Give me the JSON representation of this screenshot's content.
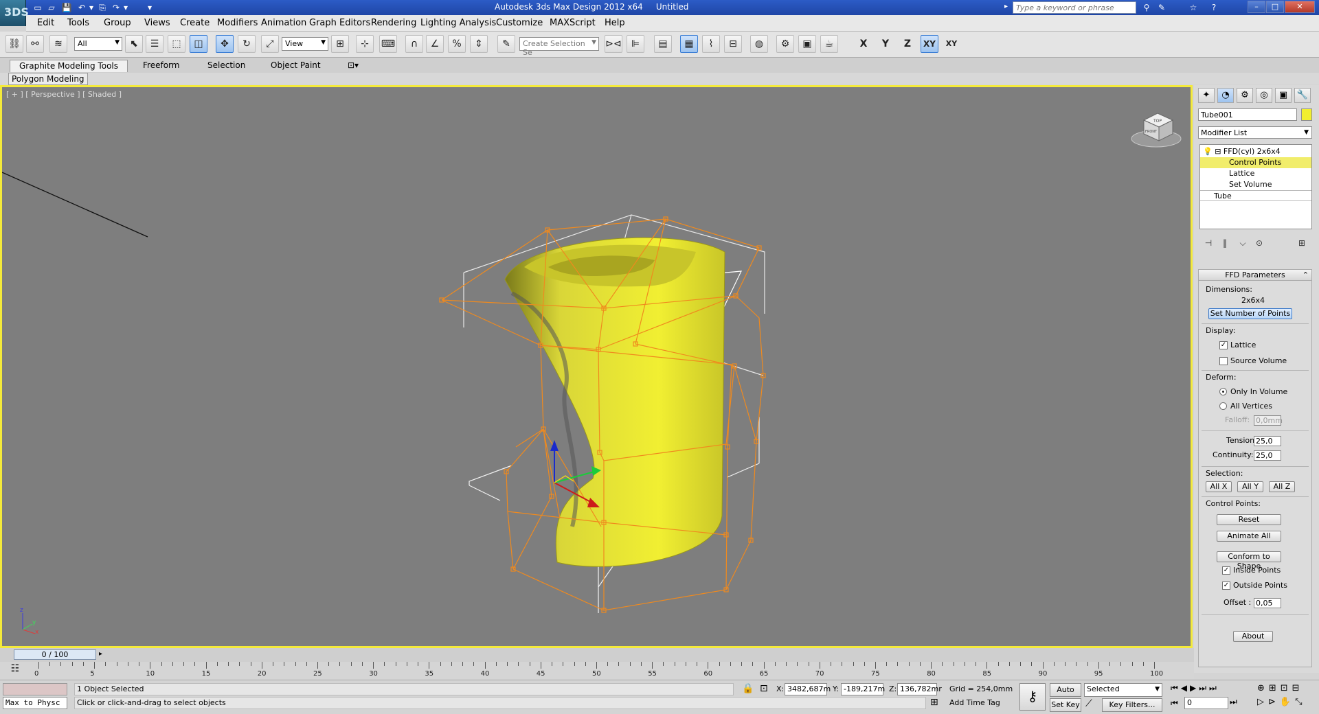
{
  "window": {
    "app_logo": "3DS",
    "title": "Autodesk 3ds Max Design 2012 x64     Untitled",
    "search_placeholder": "Type a keyword or phrase",
    "min": "–",
    "max": "□",
    "close": "✕"
  },
  "quick_access": [
    "▭",
    "▱",
    "💾",
    "↶",
    "▾",
    "⎘",
    "↷",
    "▾",
    "▾"
  ],
  "menu": [
    "Edit",
    "Tools",
    "Group",
    "Views",
    "Create",
    "Modifiers",
    "Animation",
    "Graph Editors",
    "Rendering",
    "Lighting Analysis",
    "Customize",
    "MAXScript",
    "Help"
  ],
  "toolbar": {
    "filter_value": "All",
    "refcoord_value": "View",
    "selection_set_placeholder": "Create Selection Se",
    "axis": {
      "x": "X",
      "y": "Y",
      "z": "Z",
      "xy": "XY",
      "xy2": "XY"
    }
  },
  "ribbon": {
    "tabs": [
      "Graphite Modeling Tools",
      "Freeform",
      "Selection",
      "Object Paint"
    ],
    "panel": "Polygon Modeling"
  },
  "viewport": {
    "label": "[ + ] [ Perspective ] [ Shaded ]",
    "viewcube_top": "TOP",
    "viewcube_front": "FRONT",
    "gizmo": {
      "x": "x",
      "y": "y",
      "z": "z"
    }
  },
  "command_panel": {
    "tabs": [
      "✦",
      "◔",
      "⚙",
      "◎",
      "▣",
      "🔧"
    ],
    "object_name": "Tube001",
    "object_color": "#f1ef2f",
    "modifier_list": "Modifier List",
    "stack": [
      {
        "label": "FFD(cyl) 2x6x4",
        "indent": 0,
        "selected": false
      },
      {
        "label": "Control Points",
        "indent": 1,
        "selected": true
      },
      {
        "label": "Lattice",
        "indent": 1,
        "selected": false
      },
      {
        "label": "Set Volume",
        "indent": 1,
        "selected": false
      },
      {
        "label": "Tube",
        "indent": 0,
        "selected": false
      }
    ],
    "stack_tools": [
      "⊣",
      "‖",
      "⌵",
      "⊙",
      "⊞"
    ],
    "ffd": {
      "title": "FFD Parameters",
      "dimensions_label": "Dimensions:",
      "dimensions_value": "2x6x4",
      "set_points_btn": "Set Number of Points",
      "display_label": "Display:",
      "lattice": "Lattice",
      "lattice_checked": true,
      "source_volume": "Source Volume",
      "source_volume_checked": false,
      "deform_label": "Deform:",
      "only_in_volume": "Only In Volume",
      "all_vertices": "All Vertices",
      "falloff_label": "Falloff:",
      "falloff_value": "0,0mm",
      "tension_label": "Tension:",
      "tension_value": "25,0",
      "continuity_label": "Continuity:",
      "continuity_value": "25,0",
      "selection_label": "Selection:",
      "all_x": "All X",
      "all_y": "All Y",
      "all_z": "All Z",
      "control_points_label": "Control Points:",
      "reset": "Reset",
      "animate_all": "Animate All",
      "conform": "Conform to Shape",
      "inside_points": "Inside Points",
      "inside_checked": true,
      "outside_points": "Outside Points",
      "outside_checked": true,
      "offset_label": "Offset :",
      "offset_value": "0,05",
      "about": "About"
    }
  },
  "timeline": {
    "slider": "0 / 100",
    "ticks": [
      "0",
      "5",
      "10",
      "15",
      "20",
      "25",
      "30",
      "35",
      "40",
      "45",
      "50",
      "55",
      "60",
      "65",
      "70",
      "75",
      "80",
      "85",
      "90",
      "95",
      "100"
    ]
  },
  "status": {
    "maxscript": "Max to Physc",
    "objects_selected": "1 Object Selected",
    "prompt": "Click or click-and-drag to select objects",
    "x_label": "X:",
    "x_value": "3482,687m",
    "y_label": "Y:",
    "y_value": "-189,217m",
    "z_label": "Z:",
    "z_value": "136,782mr",
    "grid": "Grid = 254,0mm",
    "add_time_tag": "Add Time Tag",
    "auto_key": "Auto Key",
    "set_key": "Set Key",
    "selected_combo": "Selected",
    "key_filters": "Key Filters...",
    "frame_value": "0"
  }
}
